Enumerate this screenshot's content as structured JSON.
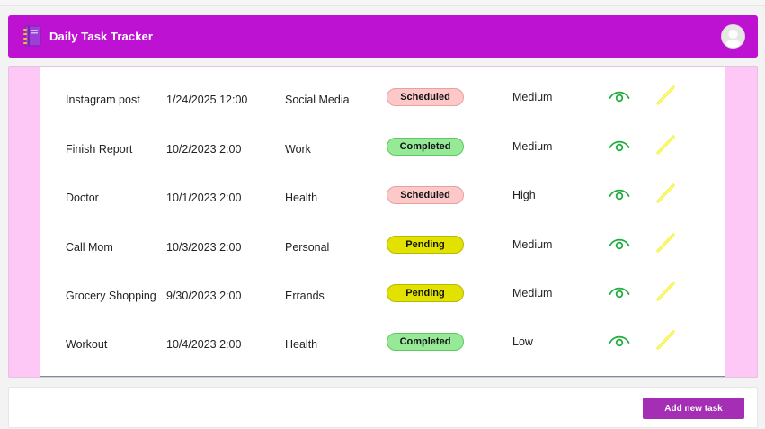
{
  "header": {
    "title": "Daily Task Tracker",
    "app_icon": "notebook-icon",
    "avatar_icon": "user-avatar-icon"
  },
  "colors": {
    "header_bg": "#bd12d2",
    "panel_bg": "#fdc8f6",
    "scheduled": "#fdc8c8",
    "completed": "#96e996",
    "pending": "#e2e200",
    "view_icon": "#1fae3e",
    "edit_icon": "#f5f03a",
    "add_button": "#a42fb4"
  },
  "tasks": [
    {
      "name": "Instagram post",
      "date": "1/24/2025 12:00",
      "category": "Social Media",
      "status": "Scheduled",
      "priority": "Medium"
    },
    {
      "name": "Finish Report",
      "date": "10/2/2023 2:00",
      "category": "Work",
      "status": "Completed",
      "priority": "Medium"
    },
    {
      "name": "Doctor",
      "date": "10/1/2023 2:00",
      "category": "Health",
      "status": "Scheduled",
      "priority": "High"
    },
    {
      "name": "Call Mom",
      "date": "10/3/2023 2:00",
      "category": "Personal",
      "status": "Pending",
      "priority": "Medium"
    },
    {
      "name": "Grocery Shopping",
      "date": "9/30/2023 2:00",
      "category": "Errands",
      "status": "Pending",
      "priority": "Medium"
    },
    {
      "name": "Workout",
      "date": "10/4/2023 2:00",
      "category": "Health",
      "status": "Completed",
      "priority": "Low"
    }
  ],
  "footer": {
    "add_label": "Add new task"
  }
}
